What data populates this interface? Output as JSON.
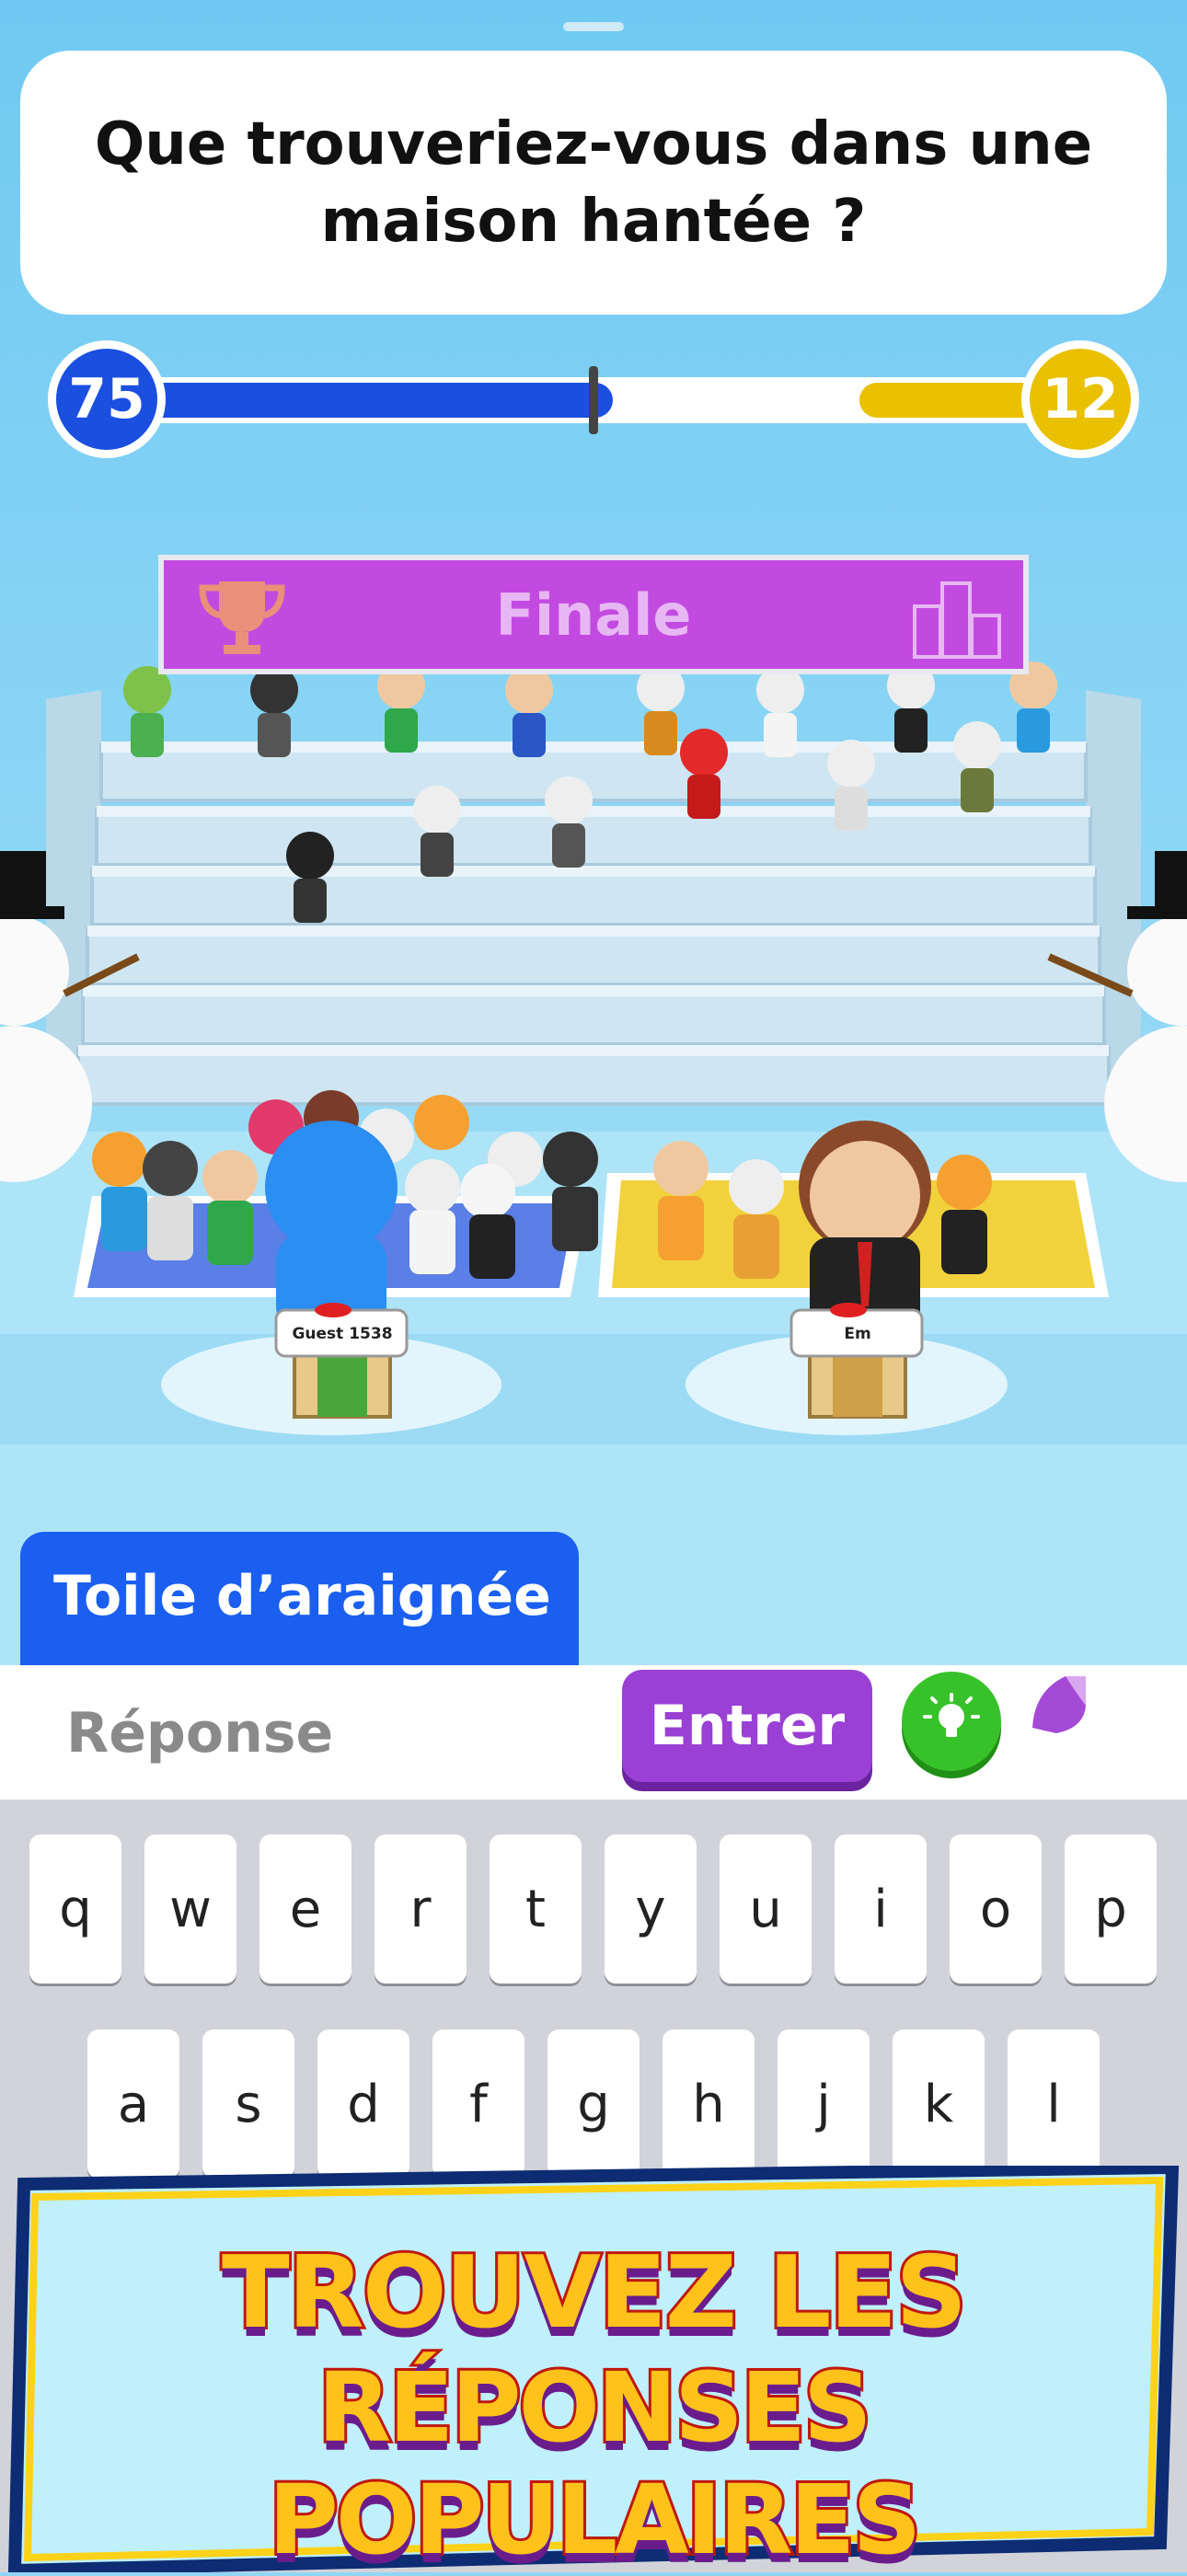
{
  "question": {
    "text": "Que trouveriez-vous dans une maison hantée ?"
  },
  "scoreboard": {
    "left_score": "75",
    "right_score": "12",
    "left_progress": 0.52,
    "right_progress": 0.23,
    "left_color": "#1a4fe0",
    "right_color": "#e9c100"
  },
  "stage": {
    "banner_title": "Finale",
    "trophy_icon": "trophy-icon",
    "city_icon": "city-icon"
  },
  "players": {
    "left_name": "Guest 1538",
    "right_name": "Em"
  },
  "answer": {
    "submitted": "Toile d’araignée"
  },
  "input": {
    "placeholder": "Réponse",
    "enter_label": "Entrer",
    "hint_icon": "lightbulb-icon"
  },
  "keyboard": {
    "row1": [
      "q",
      "w",
      "e",
      "r",
      "t",
      "y",
      "u",
      "i",
      "o",
      "p"
    ],
    "row2": [
      "a",
      "s",
      "d",
      "f",
      "g",
      "h",
      "j",
      "k",
      "l"
    ]
  },
  "promo": {
    "line1": "TROUVEZ LES",
    "line2": "RÉPONSES POPULAIRES"
  }
}
